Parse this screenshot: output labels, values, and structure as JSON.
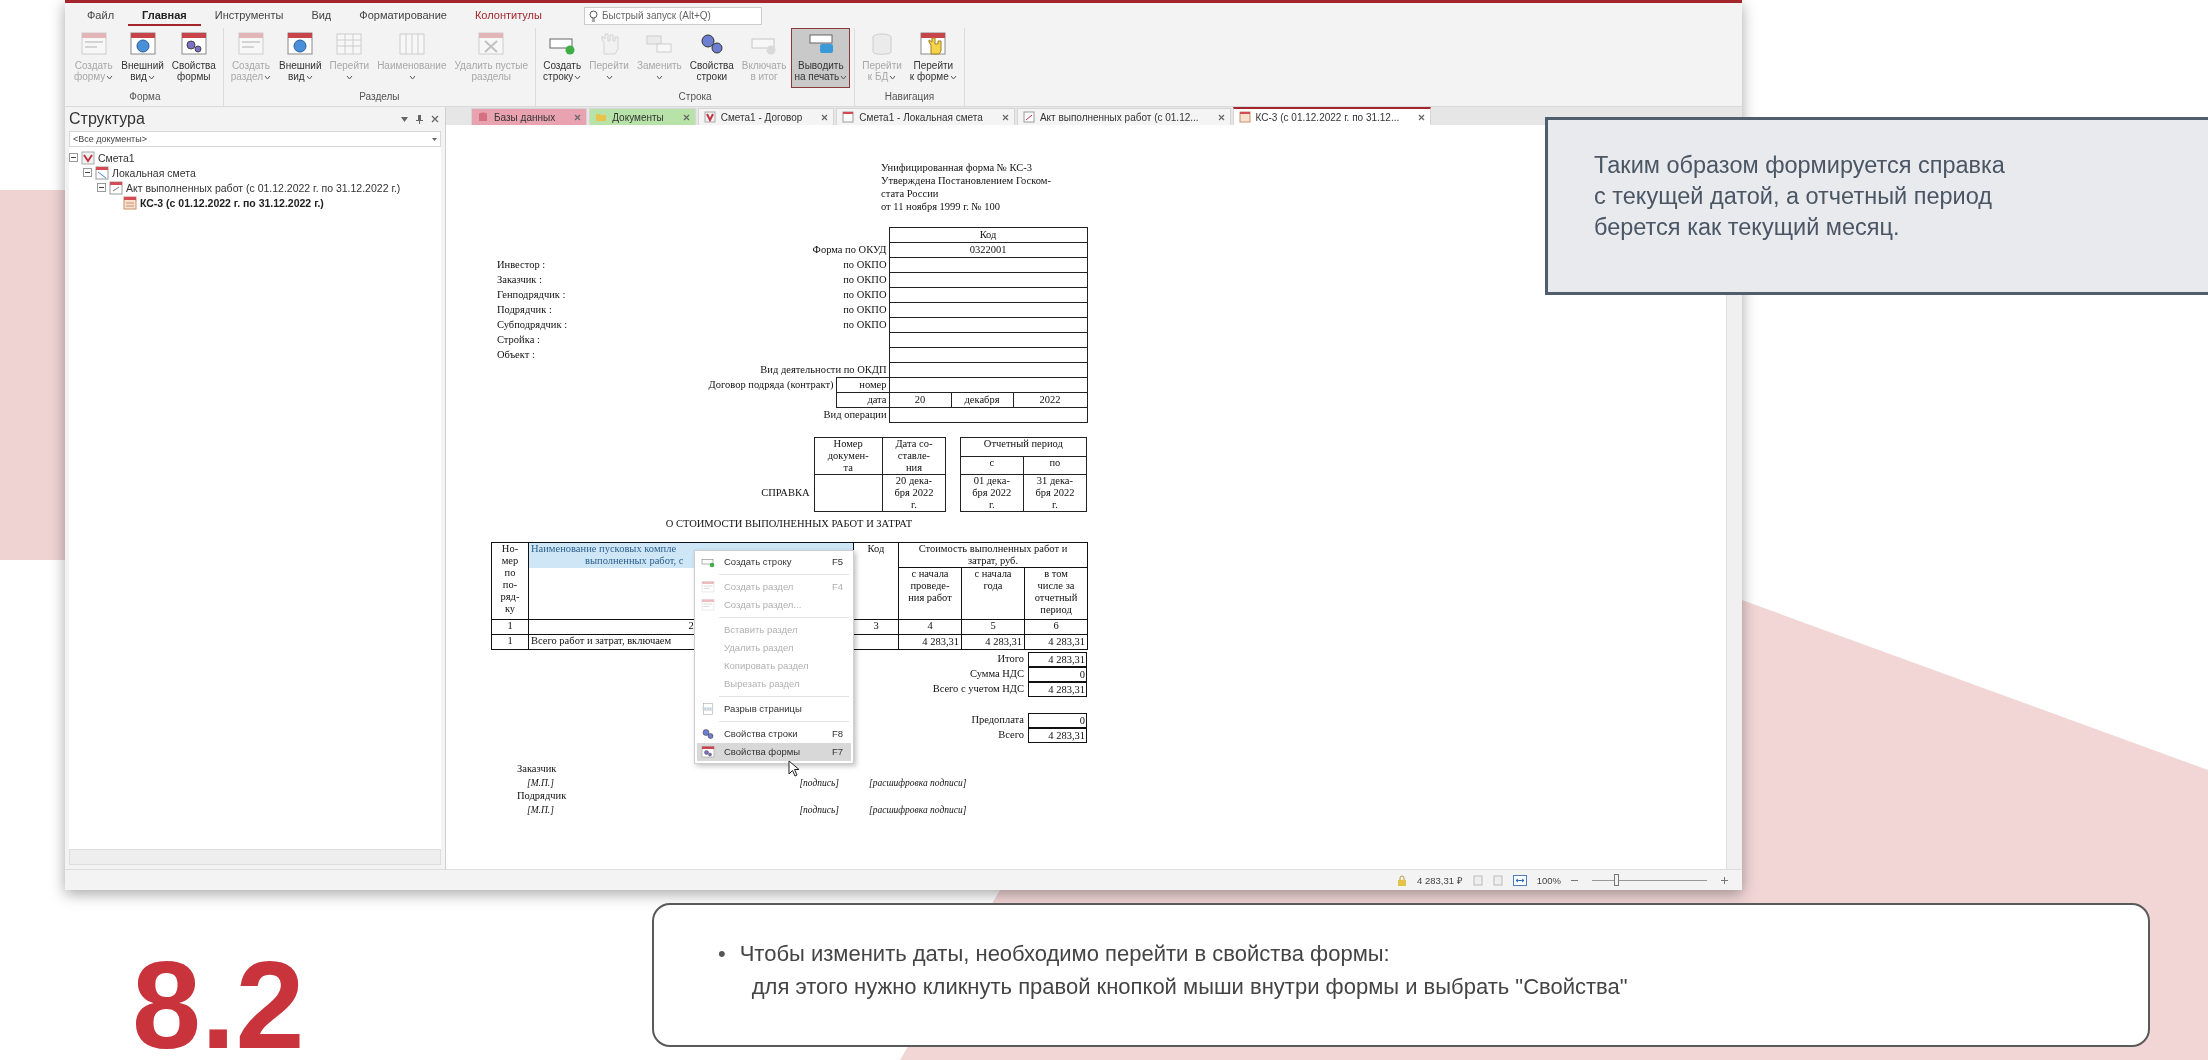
{
  "slide": {
    "callout_lines": [
      "Таким образом формируется справка",
      "с текущей датой, а отчетный период",
      "берется как текущий месяц."
    ],
    "note": {
      "bullet": "•",
      "lines": [
        "Чтобы изменить даты, необходимо перейти в свойства формы:",
        "для этого нужно кликнуть правой кнопкой мыши внутри формы и выбрать \"Свойства\""
      ]
    },
    "number": "8.2"
  },
  "window": {
    "ribbon_tabs": [
      {
        "label": "Файл",
        "selected": false,
        "contextual": false
      },
      {
        "label": "Главная",
        "selected": true,
        "contextual": false
      },
      {
        "label": "Инструменты",
        "selected": false,
        "contextual": false
      },
      {
        "label": "Вид",
        "selected": false,
        "contextual": false
      },
      {
        "label": "Форматирование",
        "selected": false,
        "contextual": false
      },
      {
        "label": "Колонтитулы",
        "selected": false,
        "contextual": true
      }
    ],
    "search": {
      "placeholder": "Быстрый запуск (Alt+Q)"
    },
    "ribbon_groups": [
      {
        "label": "Форма",
        "buttons": [
          {
            "lines": [
              "Создать",
              "форму"
            ],
            "caret": true,
            "disabled": true,
            "pressed": false
          },
          {
            "lines": [
              "Внешний",
              "вид"
            ],
            "caret": true,
            "disabled": false,
            "pressed": false
          },
          {
            "lines": [
              "Свойства",
              "формы"
            ],
            "caret": false,
            "disabled": false,
            "pressed": false
          }
        ]
      },
      {
        "label": "Разделы",
        "buttons": [
          {
            "lines": [
              "Создать",
              "раздел"
            ],
            "caret": true,
            "disabled": true,
            "pressed": false
          },
          {
            "lines": [
              "Внешний",
              "вид"
            ],
            "caret": true,
            "disabled": false,
            "pressed": false
          },
          {
            "lines": [
              "Перейти"
            ],
            "caret": true,
            "disabled": true,
            "pressed": false
          },
          {
            "lines": [
              "Наименование"
            ],
            "caret": true,
            "disabled": true,
            "pressed": false
          },
          {
            "lines": [
              "Удалить пустые",
              "разделы"
            ],
            "caret": false,
            "disabled": true,
            "pressed": false
          }
        ]
      },
      {
        "label": "Строка",
        "buttons": [
          {
            "lines": [
              "Создать",
              "строку"
            ],
            "caret": true,
            "disabled": false,
            "pressed": false
          },
          {
            "lines": [
              "Перейти"
            ],
            "caret": true,
            "disabled": true,
            "pressed": false
          },
          {
            "lines": [
              "Заменить"
            ],
            "caret": true,
            "disabled": true,
            "pressed": false
          },
          {
            "lines": [
              "Свойства",
              "строки"
            ],
            "caret": false,
            "disabled": false,
            "pressed": false
          },
          {
            "lines": [
              "Включать",
              "в итог"
            ],
            "caret": false,
            "disabled": true,
            "pressed": false
          },
          {
            "lines": [
              "Выводить",
              "на печать"
            ],
            "caret": true,
            "disabled": false,
            "pressed": true
          }
        ]
      },
      {
        "label": "Навигация",
        "buttons": [
          {
            "lines": [
              "Перейти",
              "к БД"
            ],
            "caret": true,
            "disabled": true,
            "pressed": false
          },
          {
            "lines": [
              "Перейти",
              "к форме"
            ],
            "caret": true,
            "disabled": false,
            "pressed": false
          }
        ]
      }
    ],
    "structure_panel": {
      "title": "Структура",
      "filter": "<Все документы>",
      "tree": [
        {
          "label": "Смета1",
          "expanded": true,
          "selected": false,
          "children": [
            {
              "label": "Локальная смета",
              "expanded": true,
              "selected": false,
              "children": [
                {
                  "label": "Акт выполненных работ (с 01.12.2022 г. по 31.12.2022 г.)",
                  "expanded": true,
                  "selected": false,
                  "children": [
                    {
                      "label": "КС-3 (с 01.12.2022 г. по 31.12.2022 г.)",
                      "selected": true
                    }
                  ]
                }
              ]
            }
          ]
        }
      ]
    },
    "document_tabs": [
      {
        "label": "Базы данных",
        "color": "#e9a3b0",
        "selected": false
      },
      {
        "label": "Документы",
        "color": "#b7e3a9",
        "selected": false
      },
      {
        "label": "Смета1 - Договор",
        "selected": false
      },
      {
        "label": "Смета1 - Локальная смета",
        "selected": false
      },
      {
        "label": "Акт выполненных работ (с 01.12...",
        "selected": false
      },
      {
        "label": "КС-3 (с 01.12.2022 г. по 31.12...",
        "selected": true
      }
    ],
    "document": {
      "header_lines": [
        "Унифицированная форма № КС-3",
        "Утверждена Постановлением Госком-",
        "стата России",
        "от 11 ноября 1999 г. № 100"
      ],
      "code_table": {
        "header": "Код",
        "rows": [
          {
            "label": "Форма по ОКУД",
            "value": "0322001"
          },
          {
            "party": "Инвестор :",
            "label": "по ОКПО"
          },
          {
            "party": "Заказчик :",
            "label": "по ОКПО"
          },
          {
            "party": "Генподрядчик :",
            "label": "по ОКПО"
          },
          {
            "party": "Подрядчик :",
            "label": "по ОКПО"
          },
          {
            "party": "Субподрядчик :",
            "label": "по ОКПО"
          },
          {
            "party": "Стройка :"
          },
          {
            "party": "Объект :"
          },
          {
            "label": "Вид деятельности по ОКДП"
          },
          {
            "label": "Договор подряда (контракт)",
            "sublabel": "номер"
          },
          {
            "sublabel": "дата",
            "values": [
              "20",
              "декабря",
              "2022"
            ]
          },
          {
            "label": "Вид операции"
          }
        ]
      },
      "certificate": {
        "label": "СПРАВКА",
        "number_header": [
          "Номер",
          "докумен-",
          "та"
        ],
        "date_header": [
          "Дата со-",
          "ставле-",
          "ния"
        ],
        "date": [
          "20 дека-",
          "бря 2022",
          "г."
        ],
        "period_header": "Отчетный период",
        "from_header": "с",
        "to_header": "по",
        "from": [
          "01 дека-",
          "бря 2022",
          "г."
        ],
        "to": [
          "31 дека-",
          "бря 2022",
          "г."
        ]
      },
      "title": "О СТОИМОСТИ ВЫПОЛНЕННЫХ РАБОТ И ЗАТРАТ",
      "cost_table": {
        "header": [
          {
            "lines": [
              "Но-",
              "мер",
              "по",
              "по-",
              "ряд-",
              "ку"
            ],
            "selected": false
          },
          {
            "lines": [
              "Наименование пусковых компле",
              "выполненных работ, с"
            ],
            "selected": true
          },
          {
            "lines": [
              "Код"
            ],
            "selected": false
          },
          {
            "lines": [
              "Стоимость выполненных работ и",
              "затрат, руб."
            ],
            "selected": false
          }
        ],
        "subheader": [
          [
            "с начала",
            "проведе-",
            "ния работ"
          ],
          [
            "с начала",
            "года"
          ],
          [
            "в том",
            "числе за",
            "отчетный",
            "период"
          ]
        ],
        "rows": [
          {
            "number": "1",
            "name": "2",
            "code": "3",
            "from_start": "4",
            "from_year": "5",
            "period": "6"
          },
          {
            "number": "1",
            "name": "Всего работ и затрат, включаем",
            "from_start": "4 283,31",
            "from_year": "4 283,31",
            "period": "4 283,31"
          }
        ]
      },
      "totals": [
        {
          "label": "Итого",
          "value": "4 283,31"
        },
        {
          "label": "Сумма НДС",
          "value": "0"
        },
        {
          "label": "Всего с учетом НДС",
          "value": "4 283,31"
        }
      ],
      "payments": [
        {
          "label": "Предоплата",
          "value": "0"
        },
        {
          "label": "Всего",
          "value": "4 283,31"
        }
      ],
      "signatures": [
        {
          "role": "Заказчик",
          "stamp": "[М.П.]",
          "signature": "[подпись]",
          "decoding": "[расшифровка подписи]"
        },
        {
          "role": "Подрядчик",
          "stamp": "[М.П.]",
          "signature": "[подпись]",
          "decoding": "[расшифровка подписи]"
        }
      ]
    },
    "context_menu": [
      {
        "kind": "item",
        "label": "Создать строку",
        "shortcut": "F5",
        "disabled": false,
        "selected": false
      },
      {
        "kind": "separator"
      },
      {
        "kind": "item",
        "label": "Создать раздел",
        "shortcut": "F4",
        "disabled": true,
        "selected": false
      },
      {
        "kind": "item",
        "label": "Создать раздел...",
        "disabled": true,
        "selected": false
      },
      {
        "kind": "separator"
      },
      {
        "kind": "item",
        "label": "Вставить раздел",
        "disabled": true,
        "selected": false
      },
      {
        "kind": "item",
        "label": "Удалить раздел",
        "disabled": true,
        "selected": false
      },
      {
        "kind": "item",
        "label": "Копировать раздел",
        "disabled": true,
        "selected": false
      },
      {
        "kind": "item",
        "label": "Вырезать раздел",
        "disabled": true,
        "selected": false
      },
      {
        "kind": "separator"
      },
      {
        "kind": "item",
        "label": "Разрыв страницы",
        "disabled": false,
        "selected": false
      },
      {
        "kind": "separator"
      },
      {
        "kind": "item",
        "label": "Свойства строки",
        "shortcut": "F8",
        "disabled": false,
        "selected": false
      },
      {
        "kind": "item",
        "label": "Свойства формы",
        "shortcut": "F7",
        "disabled": false,
        "selected": true
      }
    ],
    "status_bar": {
      "total": "4 283,31 ₽",
      "zoom": "100%",
      "zoom_slider": {
        "level": 0.2
      }
    }
  }
}
